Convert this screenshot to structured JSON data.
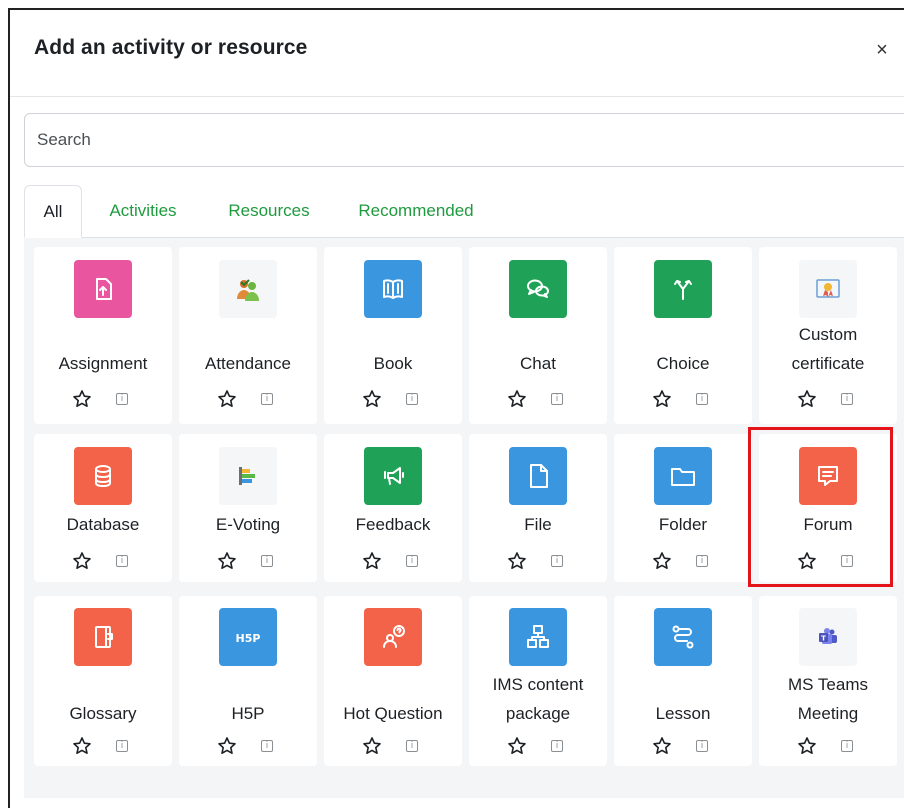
{
  "modal": {
    "title": "Add an activity or resource",
    "close_symbol": "×"
  },
  "search": {
    "placeholder": "Search",
    "value": ""
  },
  "tabs": [
    {
      "label": "All",
      "active": true
    },
    {
      "label": "Activities",
      "active": false
    },
    {
      "label": "Resources",
      "active": false
    },
    {
      "label": "Recommended",
      "active": false
    }
  ],
  "colors": {
    "tab_link": "#1f9b3f",
    "assessment": "#f164a9",
    "collaboration": "#f2634a",
    "communication": "#1fa257",
    "content": "#3b96e0",
    "highlight": "#e4141b"
  },
  "activities": [
    {
      "name": "Assignment",
      "icon": "assignment-icon",
      "color": "#e9569f"
    },
    {
      "name": "Attendance",
      "icon": "attendance-icon",
      "color": "plain"
    },
    {
      "name": "Book",
      "icon": "book-icon",
      "color": "#3b96e0"
    },
    {
      "name": "Chat",
      "icon": "chat-icon",
      "color": "#1fa257"
    },
    {
      "name": "Choice",
      "icon": "choice-icon",
      "color": "#1fa257"
    },
    {
      "name": "Custom certificate",
      "icon": "certificate-icon",
      "color": "plain"
    },
    {
      "name": "Database",
      "icon": "database-icon",
      "color": "#f2634a"
    },
    {
      "name": "E-Voting",
      "icon": "evoting-icon",
      "color": "plain"
    },
    {
      "name": "Feedback",
      "icon": "feedback-icon",
      "color": "#1fa257"
    },
    {
      "name": "File",
      "icon": "file-icon",
      "color": "#3b96e0"
    },
    {
      "name": "Folder",
      "icon": "folder-icon",
      "color": "#3b96e0"
    },
    {
      "name": "Forum",
      "icon": "forum-icon",
      "color": "#f2634a",
      "highlighted": true
    },
    {
      "name": "Glossary",
      "icon": "glossary-icon",
      "color": "#f2634a"
    },
    {
      "name": "H5P",
      "icon": "h5p-icon",
      "color": "#3b96e0",
      "icon_text": "H5P"
    },
    {
      "name": "Hot Question",
      "icon": "hot-question-icon",
      "color": "#f2634a"
    },
    {
      "name": "IMS content package",
      "icon": "ims-package-icon",
      "color": "#3b96e0"
    },
    {
      "name": "Lesson",
      "icon": "lesson-icon",
      "color": "#3b96e0"
    },
    {
      "name": "MS Teams Meeting",
      "icon": "ms-teams-icon",
      "color": "plain"
    }
  ]
}
